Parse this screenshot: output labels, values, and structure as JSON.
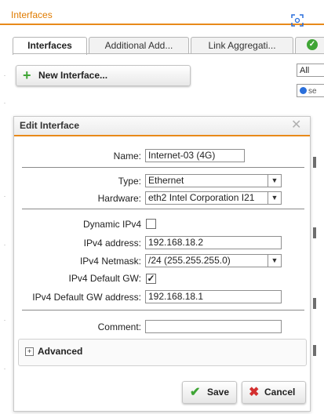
{
  "app": {
    "title": "Interfaces",
    "tabs": [
      "Interfaces",
      "Additional Add...",
      "Link Aggregati..."
    ],
    "new_button": "New Interface...",
    "side_select_value": "All",
    "side_search_placeholder": "se",
    "accent_color": "#e88a1a",
    "success_color": "#3fa535"
  },
  "dialog": {
    "title": "Edit Interface",
    "name_label": "Name:",
    "name_value": "Internet-03 (4G)",
    "type_label": "Type:",
    "type_value": "Ethernet",
    "hardware_label": "Hardware:",
    "hardware_value": "eth2 Intel Corporation I21",
    "dynamic_ipv4_label": "Dynamic IPv4",
    "dynamic_ipv4_checked": false,
    "ipv4_address_label": "IPv4 address:",
    "ipv4_address_value": "192.168.18.2",
    "ipv4_netmask_label": "IPv4 Netmask:",
    "ipv4_netmask_value": "/24 (255.255.255.0)",
    "ipv4_default_gw_label": "IPv4 Default GW:",
    "ipv4_default_gw_checked": true,
    "ipv4_default_gw_address_label": "IPv4 Default GW address:",
    "ipv4_default_gw_address_value": "192.168.18.1",
    "comment_label": "Comment:",
    "comment_value": "",
    "advanced_label": "Advanced",
    "save_label": "Save",
    "cancel_label": "Cancel"
  }
}
